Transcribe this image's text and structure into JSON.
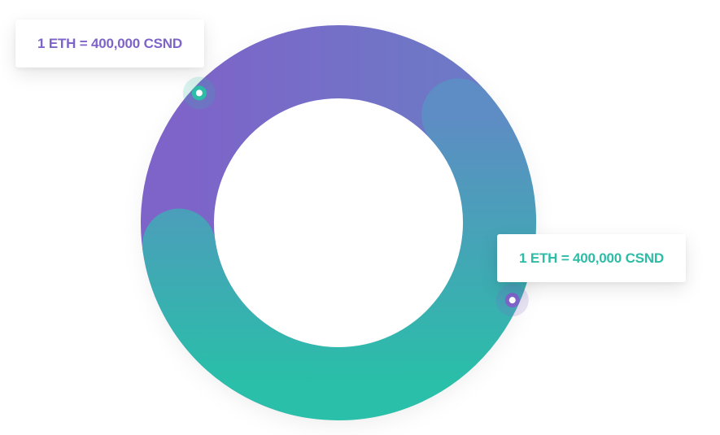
{
  "colors": {
    "purple": "#7e63c9",
    "blue": "#6d79c6",
    "teal": "#29bfa8",
    "track": "#ffffff"
  },
  "rate_cards": [
    {
      "text": "1 ETH = 400,000 CSND",
      "color": "#7e63c9"
    },
    {
      "text": "1 ETH = 400,000 CSND",
      "color": "#2dbca6"
    }
  ],
  "chart_data": {
    "type": "donut",
    "title": "",
    "series": [
      {
        "start_deg": 190,
        "end_deg": 48,
        "color_from": "#7e63c9",
        "color_to": "#6d79c6"
      },
      {
        "start_deg": 48,
        "end_deg": 262,
        "color_from": "#5e8cc4",
        "color_to": "#29bfa8"
      }
    ],
    "markers": [
      {
        "at_deg": 313,
        "color": "#2dbca6",
        "label_index": 0
      },
      {
        "at_deg": 114,
        "color": "#7e63c9",
        "label_index": 1
      }
    ]
  }
}
